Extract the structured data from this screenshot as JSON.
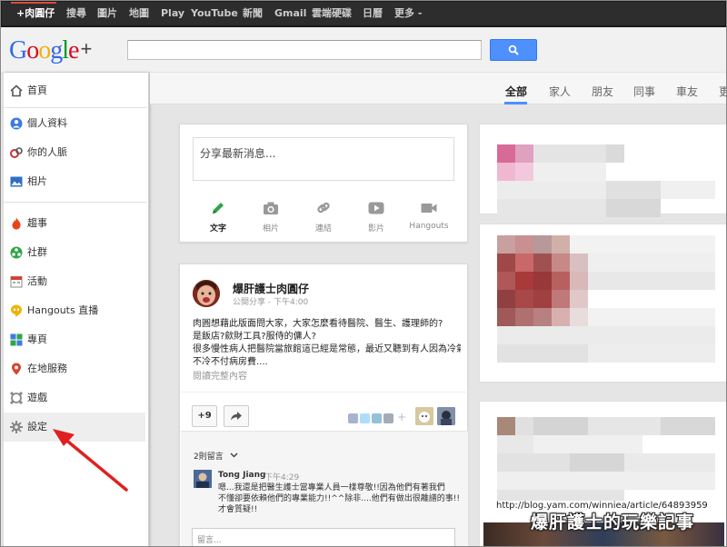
{
  "topbar": {
    "items": [
      "+肉圓仔",
      "搜尋",
      "圖片",
      "地圖",
      "Play",
      "YouTube",
      "新聞",
      "Gmail",
      "雲端硬碟",
      "日曆",
      "更多 -"
    ]
  },
  "header": {
    "logo_text": "Google",
    "logo_plus": "+"
  },
  "sidebar": {
    "items": [
      {
        "label": "首頁",
        "icon": "home-icon"
      },
      {
        "label": "個人資料",
        "icon": "profile-icon"
      },
      {
        "label": "你的人脈",
        "icon": "circles-icon"
      },
      {
        "label": "相片",
        "icon": "photos-icon"
      },
      {
        "label": "趨事",
        "icon": "trending-icon"
      },
      {
        "label": "社群",
        "icon": "communities-icon"
      },
      {
        "label": "活動",
        "icon": "events-icon"
      },
      {
        "label": "Hangouts 直播",
        "icon": "hangouts-icon"
      },
      {
        "label": "專頁",
        "icon": "pages-icon"
      },
      {
        "label": "在地服務",
        "icon": "local-icon"
      },
      {
        "label": "遊戲",
        "icon": "games-icon"
      },
      {
        "label": "設定",
        "icon": "gear-icon"
      }
    ]
  },
  "tabs": [
    "全部",
    "家人",
    "朋友",
    "同事",
    "車友"
  ],
  "sharebox": {
    "placeholder": "分享最新消息...",
    "options": [
      "文字",
      "相片",
      "連結",
      "影片",
      "Hangouts"
    ]
  },
  "post": {
    "author": "爆肝護士肉圓仔",
    "meta": "公開分享 - 下午4:00",
    "body": [
      "肉圓想藉此版面問大家，大家怎麼看待醫院、醫生、護理師的?",
      "是飯店?歛財工具?服侍的傭人?",
      "很多慢性病人把醫院當旅館這已經是常態，最近又聽到有人因為冷氣",
      "不冷不付病房費...."
    ],
    "read_more": "閱讀完整內容",
    "plus_count": "+9",
    "comment_count": "2則留言",
    "comment": {
      "author": "Tong Jiang",
      "time": "下午4:29",
      "lines": [
        "嗯...我還是把醫生護士當專業人員一樣尊敬!!因為他們有著我們",
        "不懂卻要依賴他們的專業能力!!^^除非....他們有做出很離譜的事!!",
        "才會質疑!!"
      ]
    },
    "comment_placeholder": "留言..."
  },
  "right": {
    "url": "http://blog.yam.com/winniea/article/64893959",
    "watermark": "爆肝護士的玩樂記事"
  },
  "colors": {
    "accent_blue": "#4d90fe",
    "annotation_red": "#e02020",
    "topbar_bg": "#2d2d2d"
  }
}
